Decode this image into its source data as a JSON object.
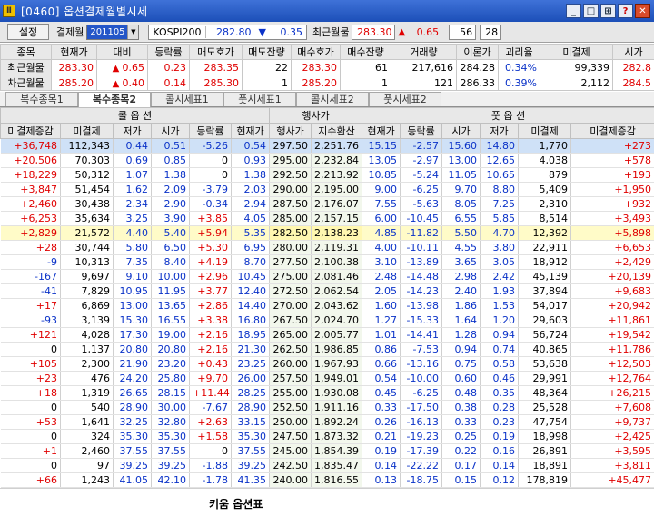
{
  "window": {
    "title": "[0460] 옵션결제월별시세",
    "icon": "app-icon",
    "buttons": [
      "minimize-icon",
      "restore-icon",
      "pin-icon",
      "help-icon",
      "close-icon"
    ],
    "button_glyphs": [
      "_",
      "□",
      "⊞",
      "?",
      "✕"
    ]
  },
  "controls": {
    "settings_label": "설정",
    "month_label": "결제월",
    "month_value": "201105",
    "kospi_label": "KOSPI200",
    "kospi_value": "282.80",
    "kospi_change": "0.35",
    "recent_label": "최근월물",
    "recent_value": "283.30",
    "recent_change": "0.65",
    "count1": "56",
    "count2": "28"
  },
  "summary": {
    "headers": [
      "종목",
      "현재가",
      "대비",
      "등락률",
      "매도호가",
      "매도잔량",
      "매수호가",
      "매수잔량",
      "거래량",
      "이론가",
      "괴리율",
      "미결제",
      "시가"
    ],
    "rows": [
      {
        "name": "최근월물",
        "price": "283.30",
        "dir": "up",
        "change": "0.65",
        "rate": "0.23",
        "ask": "283.35",
        "ask_qty": "22",
        "bid": "283.30",
        "bid_qty": "61",
        "volume": "217,616",
        "theory": "284.28",
        "gap": "0.34%",
        "oi": "99,339",
        "open": "282.8"
      },
      {
        "name": "차근월물",
        "price": "285.20",
        "dir": "up",
        "change": "0.40",
        "rate": "0.14",
        "ask": "285.30",
        "ask_qty": "1",
        "bid": "285.20",
        "bid_qty": "1",
        "volume": "121",
        "theory": "286.33",
        "gap": "0.39%",
        "oi": "2,112",
        "open": "284.5"
      }
    ]
  },
  "tabs": [
    "복수종목1",
    "복수종목2",
    "콜시세표1",
    "풋시세표1",
    "콜시세표2",
    "풋시세표2"
  ],
  "active_tab": 1,
  "main": {
    "group_call": "콜    옵    션",
    "group_mid": "행사가",
    "group_put": "풋    옵    션",
    "headers": [
      "미결제증감",
      "미결제",
      "저가",
      "시가",
      "등락률",
      "현재가",
      "행사가",
      "지수환산",
      "현재가",
      "등락률",
      "시가",
      "저가",
      "미결제",
      "미결제증감"
    ],
    "rows": [
      [
        "+36,748",
        "112,343",
        "0.44",
        "0.51",
        "-5.26",
        "0.54",
        "297.50",
        "2,251.76",
        "15.15",
        "-2.57",
        "15.60",
        "14.80",
        "1,770",
        "+273"
      ],
      [
        "+20,506",
        "70,303",
        "0.69",
        "0.85",
        "0",
        "0.93",
        "295.00",
        "2,232.84",
        "13.05",
        "-2.97",
        "13.00",
        "12.65",
        "4,038",
        "+578"
      ],
      [
        "+18,229",
        "50,312",
        "1.07",
        "1.38",
        "0",
        "1.38",
        "292.50",
        "2,213.92",
        "10.85",
        "-5.24",
        "11.05",
        "10.65",
        "879",
        "+193"
      ],
      [
        "+3,847",
        "51,454",
        "1.62",
        "2.09",
        "-3.79",
        "2.03",
        "290.00",
        "2,195.00",
        "9.00",
        "-6.25",
        "9.70",
        "8.80",
        "5,409",
        "+1,950"
      ],
      [
        "+2,460",
        "30,438",
        "2.34",
        "2.90",
        "-0.34",
        "2.94",
        "287.50",
        "2,176.07",
        "7.55",
        "-5.63",
        "8.05",
        "7.25",
        "2,310",
        "+932"
      ],
      [
        "+6,253",
        "35,634",
        "3.25",
        "3.90",
        "+3.85",
        "4.05",
        "285.00",
        "2,157.15",
        "6.00",
        "-10.45",
        "6.55",
        "5.85",
        "8,514",
        "+3,493"
      ],
      [
        "+2,829",
        "21,572",
        "4.40",
        "5.40",
        "+5.94",
        "5.35",
        "282.50",
        "2,138.23",
        "4.85",
        "-11.82",
        "5.50",
        "4.70",
        "12,392",
        "+5,898"
      ],
      [
        "+28",
        "30,744",
        "5.80",
        "6.50",
        "+5.30",
        "6.95",
        "280.00",
        "2,119.31",
        "4.00",
        "-10.11",
        "4.55",
        "3.80",
        "22,911",
        "+6,653"
      ],
      [
        "-9",
        "10,313",
        "7.35",
        "8.40",
        "+4.19",
        "8.70",
        "277.50",
        "2,100.38",
        "3.10",
        "-13.89",
        "3.65",
        "3.05",
        "18,912",
        "+2,429"
      ],
      [
        "-167",
        "9,697",
        "9.10",
        "10.00",
        "+2.96",
        "10.45",
        "275.00",
        "2,081.46",
        "2.48",
        "-14.48",
        "2.98",
        "2.42",
        "45,139",
        "+20,139"
      ],
      [
        "-41",
        "7,829",
        "10.95",
        "11.95",
        "+3.77",
        "12.40",
        "272.50",
        "2,062.54",
        "2.05",
        "-14.23",
        "2.40",
        "1.93",
        "37,894",
        "+9,683"
      ],
      [
        "+17",
        "6,869",
        "13.00",
        "13.65",
        "+2.86",
        "14.40",
        "270.00",
        "2,043.62",
        "1.60",
        "-13.98",
        "1.86",
        "1.53",
        "54,017",
        "+20,942"
      ],
      [
        "-93",
        "3,139",
        "15.30",
        "16.55",
        "+3.38",
        "16.80",
        "267.50",
        "2,024.70",
        "1.27",
        "-15.33",
        "1.64",
        "1.20",
        "29,603",
        "+11,861"
      ],
      [
        "+121",
        "4,028",
        "17.30",
        "19.00",
        "+2.16",
        "18.95",
        "265.00",
        "2,005.77",
        "1.01",
        "-14.41",
        "1.28",
        "0.94",
        "56,724",
        "+19,542"
      ],
      [
        "0",
        "1,137",
        "20.80",
        "20.80",
        "+2.16",
        "21.30",
        "262.50",
        "1,986.85",
        "0.86",
        "-7.53",
        "0.94",
        "0.74",
        "40,865",
        "+11,786"
      ],
      [
        "+105",
        "2,300",
        "21.90",
        "23.20",
        "+0.43",
        "23.25",
        "260.00",
        "1,967.93",
        "0.66",
        "-13.16",
        "0.75",
        "0.58",
        "53,638",
        "+12,503"
      ],
      [
        "+23",
        "476",
        "24.20",
        "25.80",
        "+9.70",
        "26.00",
        "257.50",
        "1,949.01",
        "0.54",
        "-10.00",
        "0.60",
        "0.46",
        "29,991",
        "+12,764"
      ],
      [
        "+18",
        "1,319",
        "26.65",
        "28.15",
        "+11.44",
        "28.25",
        "255.00",
        "1,930.08",
        "0.45",
        "-6.25",
        "0.48",
        "0.35",
        "48,364",
        "+26,215"
      ],
      [
        "0",
        "540",
        "28.90",
        "30.00",
        "-7.67",
        "28.90",
        "252.50",
        "1,911.16",
        "0.33",
        "-17.50",
        "0.38",
        "0.28",
        "25,528",
        "+7,608"
      ],
      [
        "+53",
        "1,641",
        "32.25",
        "32.80",
        "+2.63",
        "33.15",
        "250.00",
        "1,892.24",
        "0.26",
        "-16.13",
        "0.33",
        "0.23",
        "47,754",
        "+9,737"
      ],
      [
        "0",
        "324",
        "35.30",
        "35.30",
        "+1.58",
        "35.30",
        "247.50",
        "1,873.32",
        "0.21",
        "-19.23",
        "0.25",
        "0.19",
        "18,998",
        "+2,425"
      ],
      [
        "+1",
        "2,460",
        "37.55",
        "37.55",
        "0",
        "37.55",
        "245.00",
        "1,854.39",
        "0.19",
        "-17.39",
        "0.22",
        "0.16",
        "26,891",
        "+3,595"
      ],
      [
        "0",
        "97",
        "39.25",
        "39.25",
        "-1.88",
        "39.25",
        "242.50",
        "1,835.47",
        "0.14",
        "-22.22",
        "0.17",
        "0.14",
        "18,891",
        "+3,811"
      ],
      [
        "+66",
        "1,243",
        "41.05",
        "42.10",
        "-1.78",
        "41.35",
        "240.00",
        "1,816.55",
        "0.13",
        "-18.75",
        "0.15",
        "0.12",
        "178,819",
        "+45,477"
      ]
    ],
    "selected_row": 0,
    "atm_row": 6
  },
  "footer_note": "키움 옵션표",
  "colors": {
    "up": "#e00000",
    "down": "#0a32c8",
    "title_bar": "#2a5cc8",
    "selected": "#cfe1f7",
    "atm": "#fffbc8"
  }
}
